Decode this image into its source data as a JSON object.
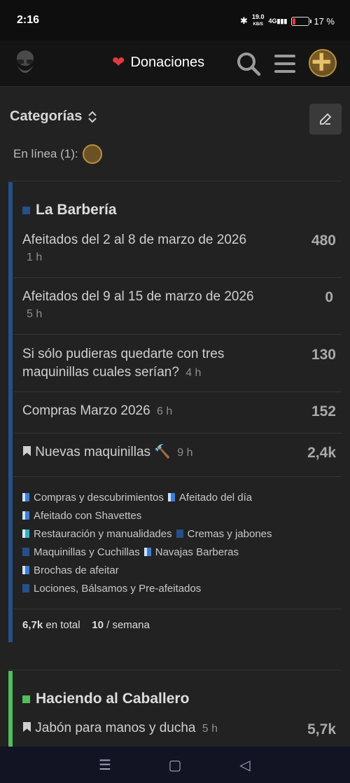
{
  "status": {
    "time": "2:16",
    "speed_value": "19.0",
    "speed_unit": "KB/S",
    "network": "4G",
    "battery_percent": "17 %",
    "battery_level": 0.17
  },
  "header": {
    "donate_label": "Donaciones",
    "icons": [
      "logo-icon",
      "heart-icon",
      "search-icon",
      "menu-icon",
      "avatar"
    ]
  },
  "page": {
    "title": "Categorías",
    "online_label": "En línea (1):"
  },
  "categories": [
    {
      "name": "La Barbería",
      "color": "#25508a",
      "topics": [
        {
          "title": "Afeitados del 2 al 8 de marzo de 2026",
          "age": "1 h",
          "count": "480"
        },
        {
          "title": "Afeitados del 9 al 15 de marzo de 2026",
          "age": "5 h",
          "count": "0"
        },
        {
          "title": "Si sólo pudieras quedarte con tres maquinillas cuales serían?",
          "age": "4 h",
          "count": "130"
        },
        {
          "title": "Compras Marzo 2026",
          "age": "6 h",
          "count": "152"
        },
        {
          "title": "Nuevas maquinillas",
          "age": "9 h",
          "count": "2,4k",
          "emoji": "🔨"
        }
      ],
      "subcategories": [
        {
          "name": "Compras y descubrimientos",
          "color": "#3d7fd6",
          "accent": "#cfe1f7"
        },
        {
          "name": "Afeitado del día",
          "color": "#3d7fd6",
          "accent": "#cfe1f7"
        },
        {
          "name": "Afeitado con Shavettes",
          "color": "#3d7fd6",
          "accent": "#cfe1f7"
        },
        {
          "name": "Restauración y manualidades",
          "color": "#35b0c5",
          "accent": "#cfeef4"
        },
        {
          "name": "Cremas y jabones",
          "color": "#25508a",
          "accent": "#25508a"
        },
        {
          "name": "Maquinillas y Cuchillas",
          "color": "#25508a",
          "accent": "#25508a"
        },
        {
          "name": "Navajas Barberas",
          "color": "#3d7fd6",
          "accent": "#cfe1f7"
        },
        {
          "name": "Brochas de afeitar",
          "color": "#3d7fd6",
          "accent": "#cfe1f7"
        },
        {
          "name": "Lociones, Bálsamos y Pre-afeitados",
          "color": "#25508a",
          "accent": "#25508a"
        }
      ],
      "stats": {
        "total_value": "6,7k",
        "total_label": "en total",
        "week_value": "10",
        "week_label": "/ semana"
      }
    },
    {
      "name": "Haciendo al Caballero",
      "color": "#4fbf5c",
      "topics": [
        {
          "title": "Jabón para manos y ducha",
          "age": "5 h",
          "count": "5,7k"
        }
      ]
    }
  ],
  "navbar": {
    "recent": "☰",
    "home": "▢",
    "back": "◁"
  }
}
